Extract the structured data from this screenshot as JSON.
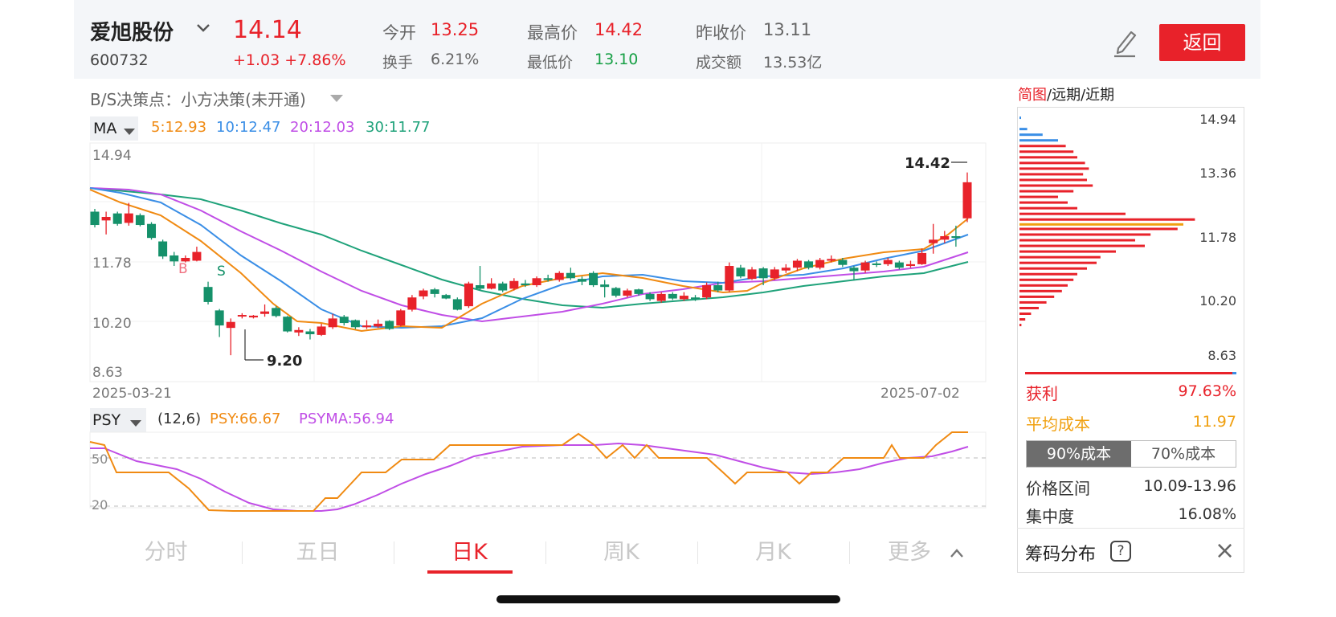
{
  "quote": {
    "name": "爱旭股份",
    "code": "600732",
    "price": "14.14",
    "change": "+1.03 +7.86%",
    "open_label": "今开",
    "open": "13.25",
    "turnover_label": "换手",
    "turnover": "6.21%",
    "high_label": "最高价",
    "high": "14.42",
    "low_label": "最低价",
    "low": "13.10",
    "prev_close_label": "昨收价",
    "prev_close": "13.11",
    "amount_label": "成交额",
    "amount": "13.53亿",
    "back_label": "返回"
  },
  "bs_label": "B/S决策点：小方决策(未开通)",
  "ma": {
    "label": "MA",
    "ma5": "5:12.93",
    "ma10": "10:12.47",
    "ma20": "20:12.03",
    "ma30": "30:11.77",
    "colors": {
      "ma5": "#f08a12",
      "ma10": "#3a8ee6",
      "ma20": "#c04ee6",
      "ma30": "#1fa27a"
    }
  },
  "psy": {
    "label": "PSY",
    "params": "(12,6)",
    "psy_text": "PSY:66.67",
    "psyma_text": "PSYMA:56.94",
    "ref_50": "50",
    "ref_20": "20",
    "colors": {
      "psy": "#f08a12",
      "psyma": "#c04ee6"
    }
  },
  "colors": {
    "up": "#e8222a",
    "down": "#15916a",
    "accent": "#e8222a"
  },
  "right_panel": {
    "tabs": {
      "a": "简图",
      "b": "/远期/近期"
    },
    "price_ticks": [
      "14.94",
      "13.36",
      "11.78",
      "10.20",
      "8.63"
    ],
    "profit_label": "获利",
    "profit": "97.63%",
    "avg_cost_label": "平均成本",
    "avg_cost": "11.97",
    "seg90": "90%成本",
    "seg70": "70%成本",
    "range_label": "价格区间",
    "range": "10.09-13.96",
    "conc_label": "集中度",
    "conc": "16.08%",
    "chip_label": "筹码分布",
    "help_icon": "?",
    "close_icon": "×"
  },
  "period_tabs": [
    "分时",
    "五日",
    "日K",
    "周K",
    "月K",
    "更多"
  ],
  "chart_data": [
    {
      "type": "candlestick",
      "ylim": [
        8.63,
        14.94
      ],
      "y_ticks": [
        "14.94",
        "11.78",
        "10.20",
        "8.63"
      ],
      "x_start": "2025-03-21",
      "x_end": "2025-07-02",
      "annotations": {
        "max": "14.42",
        "min": "9.20",
        "buy": "B",
        "sell": "S"
      },
      "candles": [
        [
          13.3,
          12.92,
          13.38,
          12.85
        ],
        [
          13.05,
          13.15,
          13.3,
          12.65
        ],
        [
          13.25,
          12.95,
          13.3,
          12.9
        ],
        [
          12.98,
          13.25,
          13.55,
          12.9
        ],
        [
          13.2,
          12.92,
          13.25,
          12.88
        ],
        [
          12.95,
          12.55,
          13.0,
          12.5
        ],
        [
          12.45,
          12.02,
          12.5,
          11.95
        ],
        [
          12.05,
          11.88,
          12.15,
          11.75
        ],
        [
          11.88,
          11.98,
          12.05,
          11.85
        ],
        [
          11.9,
          12.15,
          12.3,
          11.88
        ],
        [
          11.15,
          10.72,
          11.3,
          10.65
        ],
        [
          10.48,
          10.05,
          10.52,
          9.72
        ],
        [
          9.98,
          10.15,
          10.25,
          9.2
        ],
        [
          10.32,
          10.35,
          10.4,
          10.25
        ],
        [
          10.28,
          10.33,
          10.35,
          10.25
        ],
        [
          10.38,
          10.45,
          10.65,
          10.3
        ],
        [
          10.55,
          10.32,
          10.6,
          10.28
        ],
        [
          10.3,
          9.88,
          10.32,
          9.85
        ],
        [
          9.85,
          9.92,
          10.0,
          9.75
        ],
        [
          9.88,
          9.8,
          9.95,
          9.65
        ],
        [
          9.78,
          10.02,
          10.1,
          9.75
        ],
        [
          10.0,
          10.25,
          10.38,
          9.95
        ],
        [
          10.3,
          10.12,
          10.35,
          10.05
        ],
        [
          10.2,
          10.0,
          10.22,
          9.95
        ],
        [
          10.0,
          10.05,
          10.2,
          9.95
        ],
        [
          10.02,
          10.1,
          10.22,
          9.98
        ],
        [
          10.18,
          9.95,
          10.2,
          9.92
        ],
        [
          10.05,
          10.48,
          10.52,
          10.02
        ],
        [
          10.5,
          10.85,
          10.92,
          10.45
        ],
        [
          10.88,
          11.05,
          11.1,
          10.8
        ],
        [
          11.08,
          10.95,
          11.12,
          10.85
        ],
        [
          10.92,
          10.82,
          10.95,
          10.8
        ],
        [
          10.8,
          10.5,
          10.85,
          10.48
        ],
        [
          10.6,
          11.25,
          11.3,
          10.55
        ],
        [
          11.2,
          11.1,
          11.75,
          11.05
        ],
        [
          11.1,
          11.25,
          11.4,
          11.08
        ],
        [
          11.25,
          11.05,
          11.3,
          11.0
        ],
        [
          11.1,
          11.32,
          11.4,
          11.05
        ],
        [
          11.25,
          11.2,
          11.35,
          11.15
        ],
        [
          11.2,
          11.4,
          11.45,
          11.15
        ],
        [
          11.4,
          11.35,
          11.5,
          11.3
        ],
        [
          11.35,
          11.55,
          11.6,
          11.3
        ],
        [
          11.55,
          11.4,
          11.7,
          11.35
        ],
        [
          11.38,
          11.3,
          11.45,
          11.2
        ],
        [
          11.55,
          11.2,
          11.6,
          11.15
        ],
        [
          11.22,
          11.15,
          11.35,
          10.85
        ],
        [
          11.12,
          10.9,
          11.15,
          10.85
        ],
        [
          10.9,
          11.05,
          11.1,
          10.85
        ],
        [
          11.08,
          10.95,
          11.1,
          10.9
        ],
        [
          10.95,
          10.8,
          11.0,
          10.75
        ],
        [
          10.75,
          10.95,
          11.0,
          10.7
        ],
        [
          10.95,
          10.82,
          11.0,
          10.78
        ],
        [
          10.8,
          10.9,
          11.0,
          10.75
        ],
        [
          10.85,
          10.82,
          10.92,
          10.75
        ],
        [
          10.85,
          11.2,
          11.28,
          10.8
        ],
        [
          11.2,
          11.05,
          11.3,
          11.0
        ],
        [
          11.05,
          11.75,
          11.85,
          11.0
        ],
        [
          11.7,
          11.45,
          11.78,
          11.4
        ],
        [
          11.38,
          11.65,
          11.72,
          11.35
        ],
        [
          11.68,
          11.4,
          11.72,
          11.2
        ],
        [
          11.4,
          11.65,
          11.72,
          11.35
        ],
        [
          11.62,
          11.7,
          11.8,
          11.55
        ],
        [
          11.7,
          11.9,
          11.95,
          11.6
        ],
        [
          11.88,
          11.7,
          11.92,
          11.65
        ],
        [
          11.7,
          11.92,
          11.98,
          11.65
        ],
        [
          11.9,
          11.95,
          12.05,
          11.85
        ],
        [
          11.92,
          11.78,
          11.98,
          11.72
        ],
        [
          11.7,
          11.6,
          11.75,
          11.35
        ],
        [
          11.62,
          11.85,
          11.9,
          11.55
        ],
        [
          11.82,
          11.78,
          11.88,
          11.72
        ],
        [
          11.8,
          11.92,
          11.98,
          11.75
        ],
        [
          11.85,
          11.7,
          11.9,
          11.65
        ],
        [
          11.75,
          11.8,
          11.9,
          11.7
        ],
        [
          11.8,
          12.12,
          12.25,
          11.78
        ],
        [
          12.4,
          12.5,
          12.95,
          12.1
        ],
        [
          12.5,
          12.6,
          12.75,
          12.4
        ],
        [
          12.6,
          12.55,
          12.9,
          12.3
        ],
        [
          13.11,
          14.14,
          14.42,
          13.0
        ]
      ]
    },
    {
      "type": "chip-distribution",
      "bins": [
        [
          14.8,
          0.005,
          "blue"
        ],
        [
          14.5,
          0.04,
          "blue"
        ],
        [
          14.35,
          0.12,
          "blue"
        ],
        [
          14.2,
          0.2,
          "blue"
        ],
        [
          14.05,
          0.24,
          "red"
        ],
        [
          13.9,
          0.28,
          "red"
        ],
        [
          13.75,
          0.3,
          "red"
        ],
        [
          13.6,
          0.34,
          "red"
        ],
        [
          13.45,
          0.36,
          "red"
        ],
        [
          13.3,
          0.33,
          "red"
        ],
        [
          13.15,
          0.35,
          "red"
        ],
        [
          13.0,
          0.38,
          "red"
        ],
        [
          12.85,
          0.28,
          "red"
        ],
        [
          12.7,
          0.2,
          "red"
        ],
        [
          12.55,
          0.25,
          "red"
        ],
        [
          12.4,
          0.3,
          "red"
        ],
        [
          12.25,
          0.55,
          "red"
        ],
        [
          12.1,
          0.91,
          "red"
        ],
        [
          11.97,
          0.85,
          "orange"
        ],
        [
          11.85,
          0.82,
          "red"
        ],
        [
          11.7,
          0.68,
          "red"
        ],
        [
          11.55,
          0.6,
          "red"
        ],
        [
          11.4,
          0.65,
          "red"
        ],
        [
          11.25,
          0.5,
          "red"
        ],
        [
          11.1,
          0.42,
          "red"
        ],
        [
          10.95,
          0.4,
          "red"
        ],
        [
          10.8,
          0.35,
          "red"
        ],
        [
          10.65,
          0.3,
          "red"
        ],
        [
          10.5,
          0.28,
          "red"
        ],
        [
          10.35,
          0.25,
          "red"
        ],
        [
          10.2,
          0.22,
          "red"
        ],
        [
          10.05,
          0.18,
          "red"
        ],
        [
          9.9,
          0.14,
          "red"
        ],
        [
          9.75,
          0.1,
          "red"
        ],
        [
          9.6,
          0.06,
          "red"
        ],
        [
          9.45,
          0.03,
          "red"
        ],
        [
          9.3,
          0.01,
          "red"
        ]
      ]
    }
  ]
}
